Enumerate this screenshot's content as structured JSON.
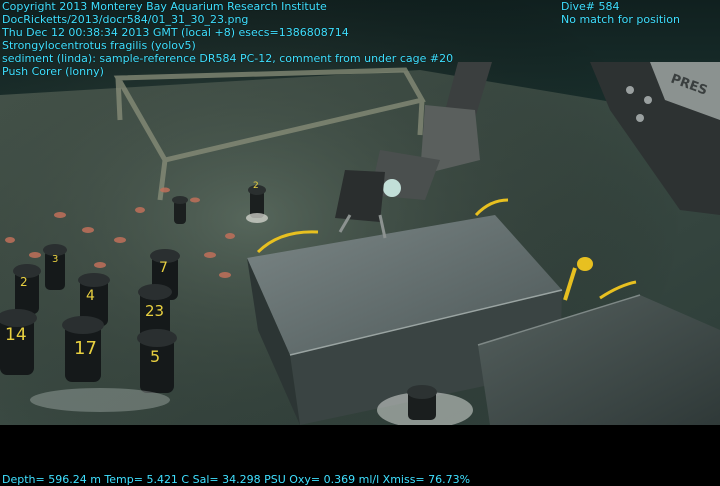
{
  "overlay": {
    "top_left": [
      "Copyright 2013 Monterey Bay Aquarium Research Institute",
      "DocRicketts/2013/docr584/01_31_30_23.png",
      "Thu Dec 12 00:38:34 2013 GMT (local +8)  esecs=1386808714",
      "Strongylocentrotus fragilis (yolov5)",
      "sediment (linda): sample-reference DR584 PC-12, comment from under cage #20",
      "Push Corer (lonny)"
    ],
    "top_right": [
      "Dive# 584",
      "No match for position"
    ],
    "bottom": "Depth= 596.24 m  Temp= 5.421 C  Sal= 34.298 PSU  Oxy= 0.369 ml/l  Xmiss= 76.73%"
  },
  "scene_labels": {
    "rack_numbers": [
      "3",
      "7",
      "4",
      "2",
      "23",
      "14",
      "17",
      "5"
    ],
    "core_tube_label": "2",
    "sign_text": "PRES"
  },
  "colors": {
    "overlay_text": "#3fe0ff",
    "water": "#1c3a3a",
    "seafloor": "#3a4a42",
    "urchin": "#c0705a",
    "yellow_marker": "#e8c020"
  }
}
